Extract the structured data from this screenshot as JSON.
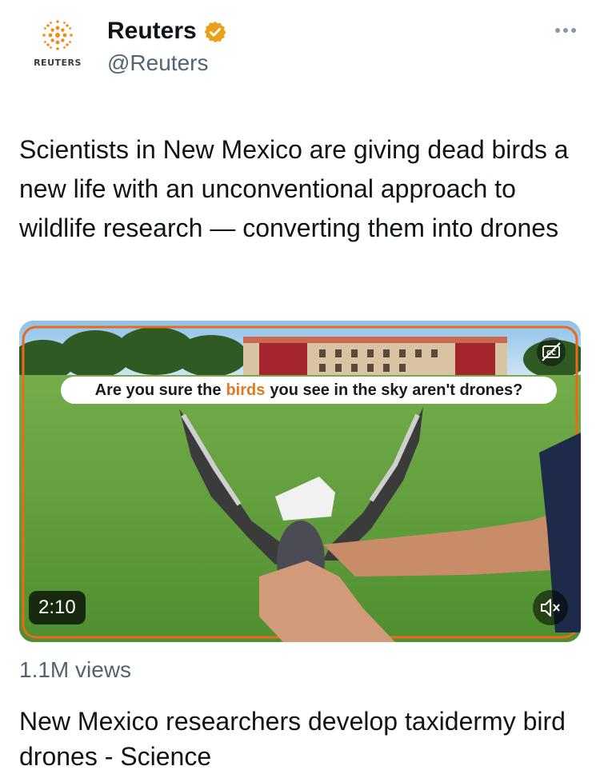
{
  "author": {
    "logo_text": "REUTERS",
    "display_name": "Reuters",
    "handle": "@Reuters",
    "verified_icon": "verified-badge-icon",
    "verified_color": "#e8a21a"
  },
  "menu": {
    "icon": "more-options-icon"
  },
  "tweet": {
    "text": "Scientists in New Mexico are giving dead birds a new life with an unconventional approach to wildlife research — converting them into drones"
  },
  "media": {
    "caption_before": "Are you sure the",
    "caption_highlight": "birds",
    "caption_after": "you see in the sky aren't drones?",
    "caption_highlight_color": "#e07a1f",
    "frame_color": "#e86a1a",
    "duration": "2:10",
    "cc_icon": "closed-captions-icon",
    "mute_icon": "muted-speaker-icon"
  },
  "stats": {
    "views": "1.1M views"
  },
  "card": {
    "title": "New Mexico researchers develop taxidermy bird drones - Science"
  }
}
